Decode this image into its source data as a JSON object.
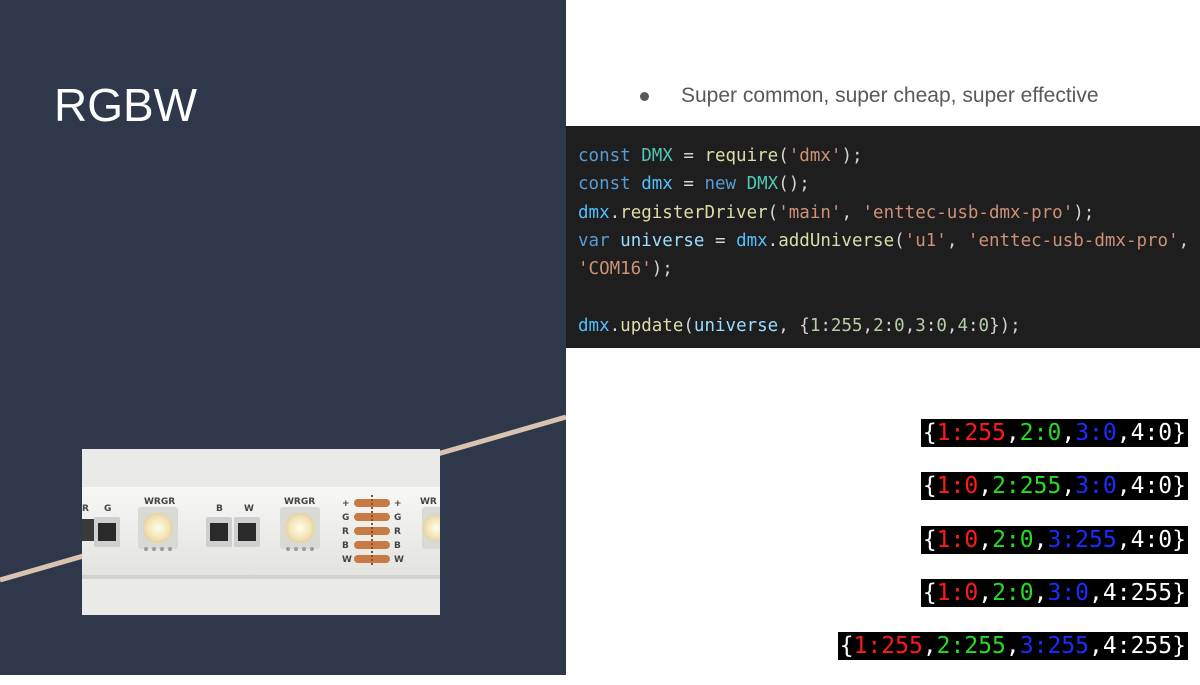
{
  "slide": {
    "title": "RGBW",
    "bullet": "Super common, super cheap, super effective"
  },
  "colors": {
    "left_panel": "#2f384a",
    "accent_line": "#d9c2b0",
    "code_bg": "#1e1e1e",
    "red_channel": "#ff1a1a",
    "green_channel": "#22dd22",
    "blue_channel": "#1a2cff",
    "white_channel": "#ffffff"
  },
  "photo": {
    "labels": {
      "left_pads": [
        "R",
        "G"
      ],
      "chip_a": "WRGR",
      "pair_a": [
        "B",
        "W"
      ],
      "chip_b": "WRGR",
      "solder_left": [
        "+",
        "G",
        "R",
        "B",
        "W"
      ],
      "solder_right": [
        "+",
        "G",
        "R",
        "B",
        "W"
      ],
      "chip_c": "WR"
    }
  },
  "code": {
    "lines": [
      [
        [
          "kw",
          "const"
        ],
        [
          "op",
          " "
        ],
        [
          "type",
          "DMX"
        ],
        [
          "op",
          " = "
        ],
        [
          "fn",
          "require"
        ],
        [
          "op",
          "("
        ],
        [
          "str",
          "'dmx'"
        ],
        [
          "op",
          ");"
        ]
      ],
      [
        [
          "kw",
          "const"
        ],
        [
          "op",
          " "
        ],
        [
          "var",
          "dmx"
        ],
        [
          "op",
          " = "
        ],
        [
          "kw",
          "new"
        ],
        [
          "op",
          " "
        ],
        [
          "type",
          "DMX"
        ],
        [
          "op",
          "();"
        ]
      ],
      [
        [
          "var",
          "dmx"
        ],
        [
          "op",
          "."
        ],
        [
          "fn",
          "registerDriver"
        ],
        [
          "op",
          "("
        ],
        [
          "str",
          "'main'"
        ],
        [
          "op",
          ", "
        ],
        [
          "str",
          "'enttec-usb-dmx-pro'"
        ],
        [
          "op",
          ");"
        ]
      ],
      [
        [
          "kw",
          "var"
        ],
        [
          "op",
          " "
        ],
        [
          "id",
          "universe"
        ],
        [
          "op",
          " = "
        ],
        [
          "var",
          "dmx"
        ],
        [
          "op",
          "."
        ],
        [
          "fn",
          "addUniverse"
        ],
        [
          "op",
          "("
        ],
        [
          "str",
          "'u1'"
        ],
        [
          "op",
          ", "
        ],
        [
          "str",
          "'enttec-usb-dmx-pro'"
        ],
        [
          "op",
          ","
        ]
      ],
      [
        [
          "str",
          "'COM16'"
        ],
        [
          "op",
          ");"
        ]
      ],
      [],
      [
        [
          "var",
          "dmx"
        ],
        [
          "op",
          "."
        ],
        [
          "fn",
          "update"
        ],
        [
          "op",
          "("
        ],
        [
          "id",
          "universe"
        ],
        [
          "op",
          ", {"
        ],
        [
          "num",
          "1"
        ],
        [
          "op",
          ":"
        ],
        [
          "num",
          "255"
        ],
        [
          "op",
          ","
        ],
        [
          "num",
          "2"
        ],
        [
          "op",
          ":"
        ],
        [
          "num",
          "0"
        ],
        [
          "op",
          ","
        ],
        [
          "num",
          "3"
        ],
        [
          "op",
          ":"
        ],
        [
          "num",
          "0"
        ],
        [
          "op",
          ","
        ],
        [
          "num",
          "4"
        ],
        [
          "op",
          ":"
        ],
        [
          "num",
          "0"
        ],
        [
          "op",
          "});"
        ]
      ]
    ]
  },
  "dmx_rows": [
    {
      "ch1": "1:255",
      "ch2": "2:0",
      "ch3": "3:0",
      "ch4": "4:0",
      "on": [
        true,
        true,
        false,
        true
      ]
    },
    {
      "ch1": "1:0",
      "ch2": "2:255",
      "ch3": "3:0",
      "ch4": "4:0",
      "on": [
        false,
        true,
        false,
        true
      ]
    },
    {
      "ch1": "1:0",
      "ch2": "2:0",
      "ch3": "3:255",
      "ch4": "4:0",
      "on": [
        false,
        true,
        false,
        true
      ]
    },
    {
      "ch1": "1:0",
      "ch2": "2:0",
      "ch3": "3:0",
      "ch4": "4:255",
      "on": [
        false,
        true,
        false,
        true
      ]
    },
    {
      "ch1": "1:255",
      "ch2": "2:255",
      "ch3": "3:255",
      "ch4": "4:255",
      "on": [
        true,
        true,
        false,
        true
      ]
    }
  ]
}
